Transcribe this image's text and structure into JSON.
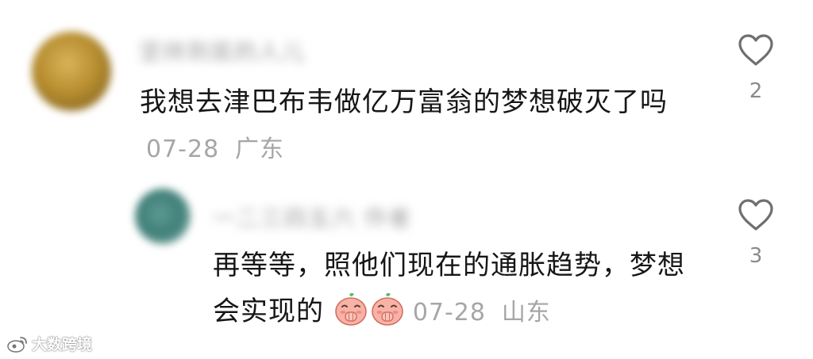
{
  "comment": {
    "username": "坚持到底的人儿",
    "text": "我想去津巴布韦做亿万富翁的梦想破灭了吗",
    "date": "07-28",
    "location": "广东",
    "likes": "2",
    "icon": "heart-outline-icon"
  },
  "reply": {
    "username": "一二三四五六 作者",
    "text": "再等等，照他们现在的通胀趋势，梦想会实现的",
    "emojis": [
      "cover-mouth-emoji",
      "cover-mouth-emoji"
    ],
    "date": "07-28",
    "location": "山东",
    "likes": "3",
    "icon": "heart-outline-icon"
  },
  "watermark": {
    "text": "大数跨境"
  },
  "colors": {
    "text": "#161616",
    "meta": "#a6a6a6",
    "like_icon": "#6f6f6f"
  }
}
